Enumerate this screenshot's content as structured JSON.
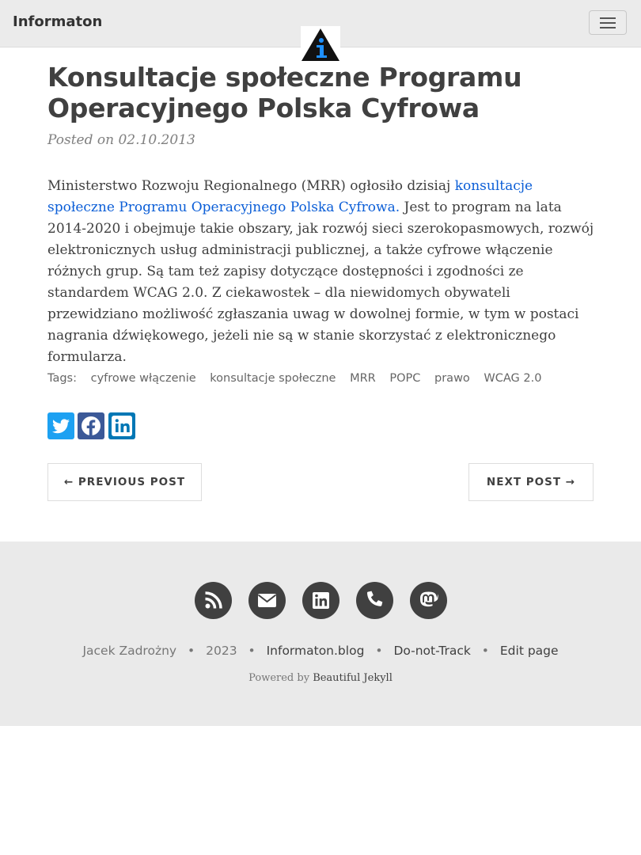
{
  "navbar": {
    "brand": "Informaton",
    "menu_icon": "hamburger-icon",
    "logo_icon": "info-triangle-logo"
  },
  "post": {
    "title": "Konsultacje społeczne Programu Operacyjnego Polska Cyfrowa",
    "meta_prefix": "Posted on",
    "date": "02.10.2013",
    "body_before_link": "Ministerstwo Rozwoju Regionalnego (MRR) ogłosiło dzisiaj ",
    "body_link": "konsultacje społeczne Programu Operacyjnego Polska Cyfrowa.",
    "body_after_link": " Jest to program na lata 2014-2020 i obejmuje takie obszary, jak rozwój sieci szerokopasmowych, rozwój elektronicznych usług administracji publicznej, a także cyfrowe włączenie różnych grup. Są tam też zapisy dotyczące dostępności i zgodności ze standardem WCAG 2.0. Z ciekawostek – dla niewidomych obywateli przewidziano możliwość zgłaszania uwag w dowolnej formie, w tym w postaci nagrania dźwiękowego, jeżeli nie są w stanie skorzystać z elektronicznego formularza."
  },
  "tags": {
    "label": "Tags:",
    "items": [
      "cyfrowe włączenie",
      "konsultacje społeczne",
      "MRR",
      "POPC",
      "prawo",
      "WCAG 2.0"
    ]
  },
  "share": {
    "icons": [
      "twitter-icon",
      "facebook-icon",
      "linkedin-icon"
    ],
    "colors": {
      "twitter": "#1da1f2",
      "facebook": "#3b5998",
      "linkedin": "#0077b5"
    }
  },
  "pager": {
    "previous": "← PREVIOUS POST",
    "next": "NEXT POST →"
  },
  "footer": {
    "social_icons": [
      "rss-icon",
      "envelope-icon",
      "linkedin-icon",
      "phone-icon",
      "mastodon-icon"
    ],
    "author": "Jacek Zadrożny",
    "year": "2023",
    "links": [
      "Informaton.blog",
      "Do-not-Track",
      "Edit page"
    ],
    "separator": "•",
    "powered_prefix": "Powered by",
    "powered_link": "Beautiful Jekyll"
  }
}
